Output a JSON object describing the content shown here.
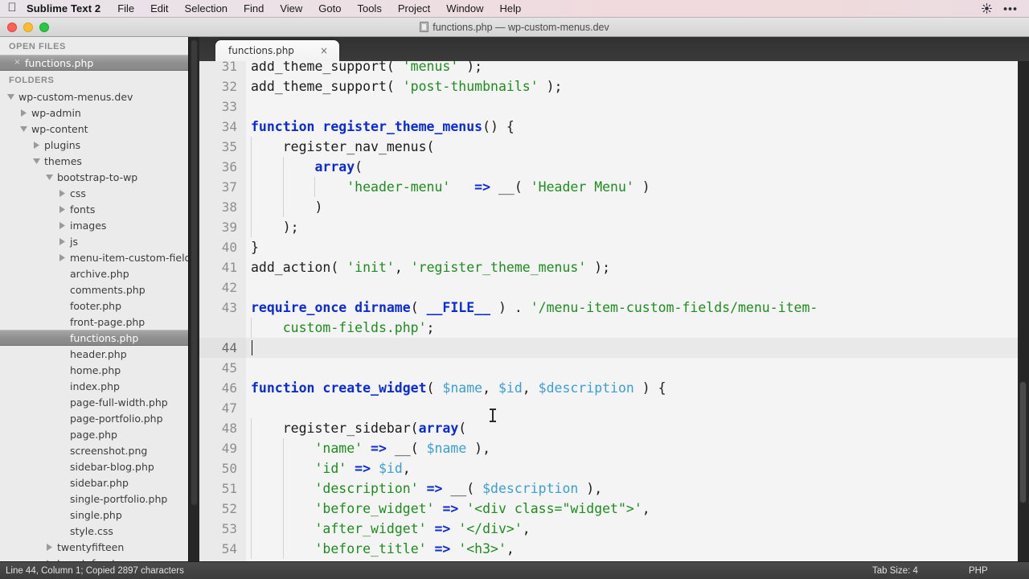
{
  "menubar": {
    "apple_icon": "apple-logo-icon",
    "app_name": "Sublime Text 2",
    "items": [
      "File",
      "Edit",
      "Selection",
      "Find",
      "View",
      "Goto",
      "Tools",
      "Project",
      "Window",
      "Help"
    ],
    "right_icons": [
      "brightness-icon",
      "more-options-icon"
    ]
  },
  "titlebar": {
    "title": "functions.php — wp-custom-menus.dev",
    "buttons": [
      "close-button",
      "minimize-button",
      "maximize-button"
    ]
  },
  "sidebar": {
    "open_files_header": "OPEN FILES",
    "open_files": [
      {
        "label": "functions.php",
        "selected": true,
        "indent": 1,
        "kind": "file",
        "close": "×"
      }
    ],
    "folders_header": "FOLDERS",
    "tree": [
      {
        "label": "wp-custom-menus.dev",
        "indent": 0,
        "arrow": "down",
        "selected": false
      },
      {
        "label": "wp-admin",
        "indent": 1,
        "arrow": "right",
        "selected": false
      },
      {
        "label": "wp-content",
        "indent": 1,
        "arrow": "down",
        "selected": false
      },
      {
        "label": "plugins",
        "indent": 2,
        "arrow": "right",
        "selected": false
      },
      {
        "label": "themes",
        "indent": 2,
        "arrow": "down",
        "selected": false
      },
      {
        "label": "bootstrap-to-wp",
        "indent": 3,
        "arrow": "down",
        "selected": false
      },
      {
        "label": "css",
        "indent": 4,
        "arrow": "right",
        "selected": false
      },
      {
        "label": "fonts",
        "indent": 4,
        "arrow": "right",
        "selected": false
      },
      {
        "label": "images",
        "indent": 4,
        "arrow": "right",
        "selected": false
      },
      {
        "label": "js",
        "indent": 4,
        "arrow": "right",
        "selected": false
      },
      {
        "label": "menu-item-custom-fields",
        "indent": 4,
        "arrow": "right",
        "selected": false
      },
      {
        "label": "archive.php",
        "indent": 4,
        "arrow": "none",
        "selected": false
      },
      {
        "label": "comments.php",
        "indent": 4,
        "arrow": "none",
        "selected": false
      },
      {
        "label": "footer.php",
        "indent": 4,
        "arrow": "none",
        "selected": false
      },
      {
        "label": "front-page.php",
        "indent": 4,
        "arrow": "none",
        "selected": false
      },
      {
        "label": "functions.php",
        "indent": 4,
        "arrow": "none",
        "selected": true
      },
      {
        "label": "header.php",
        "indent": 4,
        "arrow": "none",
        "selected": false
      },
      {
        "label": "home.php",
        "indent": 4,
        "arrow": "none",
        "selected": false
      },
      {
        "label": "index.php",
        "indent": 4,
        "arrow": "none",
        "selected": false
      },
      {
        "label": "page-full-width.php",
        "indent": 4,
        "arrow": "none",
        "selected": false
      },
      {
        "label": "page-portfolio.php",
        "indent": 4,
        "arrow": "none",
        "selected": false
      },
      {
        "label": "page.php",
        "indent": 4,
        "arrow": "none",
        "selected": false
      },
      {
        "label": "screenshot.png",
        "indent": 4,
        "arrow": "none",
        "selected": false
      },
      {
        "label": "sidebar-blog.php",
        "indent": 4,
        "arrow": "none",
        "selected": false
      },
      {
        "label": "sidebar.php",
        "indent": 4,
        "arrow": "none",
        "selected": false
      },
      {
        "label": "single-portfolio.php",
        "indent": 4,
        "arrow": "none",
        "selected": false
      },
      {
        "label": "single.php",
        "indent": 4,
        "arrow": "none",
        "selected": false
      },
      {
        "label": "style.css",
        "indent": 4,
        "arrow": "none",
        "selected": false
      },
      {
        "label": "twentyfifteen",
        "indent": 3,
        "arrow": "right",
        "selected": false
      },
      {
        "label": "twentyfourteen",
        "indent": 3,
        "arrow": "right",
        "selected": false
      }
    ]
  },
  "editor": {
    "tab": {
      "label": "functions.php",
      "close": "×"
    },
    "first_visible_line": 31,
    "active_line": 44,
    "lines": [
      {
        "n": 31,
        "clipped": true,
        "tokens": [
          {
            "t": "add_theme_support( ",
            "c": "pl"
          },
          {
            "t": "'menus'",
            "c": "str"
          },
          {
            "t": " );",
            "c": "pl"
          }
        ]
      },
      {
        "n": 32,
        "tokens": [
          {
            "t": "add_theme_support( ",
            "c": "pl"
          },
          {
            "t": "'post-thumbnails'",
            "c": "str"
          },
          {
            "t": " );",
            "c": "pl"
          }
        ]
      },
      {
        "n": 33,
        "tokens": []
      },
      {
        "n": 34,
        "tokens": [
          {
            "t": "function ",
            "c": "kw"
          },
          {
            "t": "register_theme_menus",
            "c": "fn"
          },
          {
            "t": "() {",
            "c": "pl"
          }
        ]
      },
      {
        "n": 35,
        "tokens": [
          {
            "t": "    register_nav_menus(",
            "c": "pl"
          }
        ]
      },
      {
        "n": 36,
        "tokens": [
          {
            "t": "        ",
            "c": "pl"
          },
          {
            "t": "array",
            "c": "kw"
          },
          {
            "t": "(",
            "c": "pl"
          }
        ]
      },
      {
        "n": 37,
        "tokens": [
          {
            "t": "            ",
            "c": "pl"
          },
          {
            "t": "'header-menu'",
            "c": "str"
          },
          {
            "t": "   ",
            "c": "pl"
          },
          {
            "t": "=>",
            "c": "op"
          },
          {
            "t": " __( ",
            "c": "pl"
          },
          {
            "t": "'Header Menu'",
            "c": "str"
          },
          {
            "t": " )",
            "c": "pl"
          }
        ]
      },
      {
        "n": 38,
        "tokens": [
          {
            "t": "        )",
            "c": "pl"
          }
        ]
      },
      {
        "n": 39,
        "tokens": [
          {
            "t": "    );",
            "c": "pl"
          }
        ]
      },
      {
        "n": 40,
        "tokens": [
          {
            "t": "}",
            "c": "pl"
          }
        ]
      },
      {
        "n": 41,
        "tokens": [
          {
            "t": "add_action( ",
            "c": "pl"
          },
          {
            "t": "'init'",
            "c": "str"
          },
          {
            "t": ", ",
            "c": "pl"
          },
          {
            "t": "'register_theme_menus'",
            "c": "str"
          },
          {
            "t": " );",
            "c": "pl"
          }
        ]
      },
      {
        "n": 42,
        "tokens": []
      },
      {
        "n": 43,
        "tokens": [
          {
            "t": "require_once ",
            "c": "kw"
          },
          {
            "t": "dirname",
            "c": "fn"
          },
          {
            "t": "( ",
            "c": "pl"
          },
          {
            "t": "__FILE__",
            "c": "op"
          },
          {
            "t": " ) . ",
            "c": "pl"
          },
          {
            "t": "'/menu-item-custom-fields/menu-item-",
            "c": "str"
          }
        ]
      },
      {
        "n": "",
        "wrapped": true,
        "tokens": [
          {
            "t": "    custom-fields.php'",
            "c": "str"
          },
          {
            "t": ";",
            "c": "pl"
          }
        ]
      },
      {
        "n": 44,
        "active": true,
        "caret": true,
        "tokens": []
      },
      {
        "n": 45,
        "tokens": []
      },
      {
        "n": 46,
        "tokens": [
          {
            "t": "function ",
            "c": "kw"
          },
          {
            "t": "create_widget",
            "c": "fn"
          },
          {
            "t": "( ",
            "c": "pl"
          },
          {
            "t": "$name",
            "c": "var"
          },
          {
            "t": ", ",
            "c": "pl"
          },
          {
            "t": "$id",
            "c": "var"
          },
          {
            "t": ", ",
            "c": "pl"
          },
          {
            "t": "$description",
            "c": "var"
          },
          {
            "t": " ) {",
            "c": "pl"
          }
        ]
      },
      {
        "n": 47,
        "tokens": []
      },
      {
        "n": 48,
        "tokens": [
          {
            "t": "    register_sidebar(",
            "c": "pl"
          },
          {
            "t": "array",
            "c": "kw"
          },
          {
            "t": "(",
            "c": "pl"
          }
        ]
      },
      {
        "n": 49,
        "tokens": [
          {
            "t": "        ",
            "c": "pl"
          },
          {
            "t": "'name'",
            "c": "str"
          },
          {
            "t": " ",
            "c": "pl"
          },
          {
            "t": "=>",
            "c": "op"
          },
          {
            "t": " __( ",
            "c": "pl"
          },
          {
            "t": "$name",
            "c": "var"
          },
          {
            "t": " ),",
            "c": "pl"
          }
        ]
      },
      {
        "n": 50,
        "tokens": [
          {
            "t": "        ",
            "c": "pl"
          },
          {
            "t": "'id'",
            "c": "str"
          },
          {
            "t": " ",
            "c": "pl"
          },
          {
            "t": "=>",
            "c": "op"
          },
          {
            "t": " ",
            "c": "pl"
          },
          {
            "t": "$id",
            "c": "var"
          },
          {
            "t": ",",
            "c": "pl"
          }
        ]
      },
      {
        "n": 51,
        "tokens": [
          {
            "t": "        ",
            "c": "pl"
          },
          {
            "t": "'description'",
            "c": "str"
          },
          {
            "t": " ",
            "c": "pl"
          },
          {
            "t": "=>",
            "c": "op"
          },
          {
            "t": " __( ",
            "c": "pl"
          },
          {
            "t": "$description",
            "c": "var"
          },
          {
            "t": " ),",
            "c": "pl"
          }
        ]
      },
      {
        "n": 52,
        "tokens": [
          {
            "t": "        ",
            "c": "pl"
          },
          {
            "t": "'before_widget'",
            "c": "str"
          },
          {
            "t": " ",
            "c": "pl"
          },
          {
            "t": "=>",
            "c": "op"
          },
          {
            "t": " ",
            "c": "pl"
          },
          {
            "t": "'<div class=\"widget\">'",
            "c": "str"
          },
          {
            "t": ",",
            "c": "pl"
          }
        ]
      },
      {
        "n": 53,
        "tokens": [
          {
            "t": "        ",
            "c": "pl"
          },
          {
            "t": "'after_widget'",
            "c": "str"
          },
          {
            "t": " ",
            "c": "pl"
          },
          {
            "t": "=>",
            "c": "op"
          },
          {
            "t": " ",
            "c": "pl"
          },
          {
            "t": "'</div>'",
            "c": "str"
          },
          {
            "t": ",",
            "c": "pl"
          }
        ]
      },
      {
        "n": 54,
        "tokens": [
          {
            "t": "        ",
            "c": "pl"
          },
          {
            "t": "'before_title'",
            "c": "str"
          },
          {
            "t": " ",
            "c": "pl"
          },
          {
            "t": "=>",
            "c": "op"
          },
          {
            "t": " ",
            "c": "pl"
          },
          {
            "t": "'<h3>'",
            "c": "str"
          },
          {
            "t": ",",
            "c": "pl"
          }
        ]
      }
    ]
  },
  "statusbar": {
    "left": "Line 44, Column 1; Copied 2897 characters",
    "tab_size": "Tab Size: 4",
    "language": "PHP"
  },
  "colors": {
    "keyword": "#0b2bd4",
    "string": "#1d8e1d",
    "variable": "#3a9fd4",
    "plain": "#1c1c1c",
    "editor_bg": "#f4f4f4",
    "gutter_bg": "#eaeaea",
    "sidebar_bg": "#ebebeb",
    "statusbar_bg": "#3c3c3c"
  }
}
